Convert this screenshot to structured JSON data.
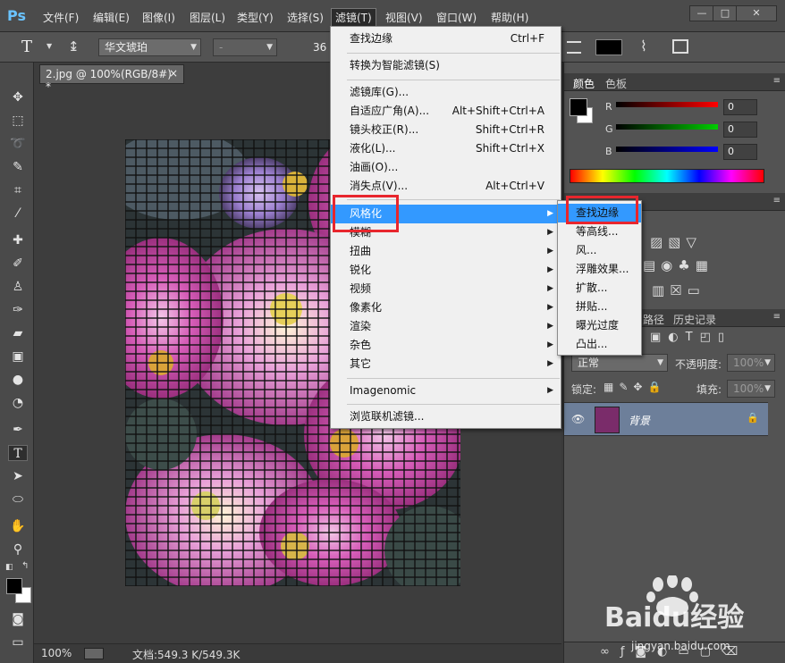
{
  "app": {
    "logo": "Ps"
  },
  "menubar": {
    "items": [
      "文件(F)",
      "编辑(E)",
      "图像(I)",
      "图层(L)",
      "类型(Y)",
      "选择(S)",
      "滤镜(T)",
      "视图(V)",
      "窗口(W)",
      "帮助(H)"
    ],
    "active": "滤镜(T)"
  },
  "window_controls": {
    "minimize": "—",
    "restore": "□",
    "close": "✕"
  },
  "options_bar": {
    "font_family": "华文琥珀",
    "font_style": "-",
    "font_size": "36"
  },
  "document": {
    "tab_title": "2.jpg @ 100%(RGB/8#) *",
    "tab_close": "×"
  },
  "status": {
    "zoom": "100%",
    "doc_info": "文档:549.3 K/549.3K"
  },
  "filter_menu": {
    "items": [
      {
        "label": "查找边缘",
        "shortcut": "Ctrl+F"
      },
      {
        "label": "转换为智能滤镜(S)"
      },
      {
        "label": "滤镜库(G)..."
      },
      {
        "label": "自适应广角(A)...",
        "shortcut": "Alt+Shift+Ctrl+A"
      },
      {
        "label": "镜头校正(R)...",
        "shortcut": "Shift+Ctrl+R"
      },
      {
        "label": "液化(L)...",
        "shortcut": "Shift+Ctrl+X"
      },
      {
        "label": "油画(O)..."
      },
      {
        "label": "消失点(V)...",
        "shortcut": "Alt+Ctrl+V"
      },
      {
        "label": "风格化",
        "submenu": true
      },
      {
        "label": "模糊",
        "submenu": true
      },
      {
        "label": "扭曲",
        "submenu": true
      },
      {
        "label": "锐化",
        "submenu": true
      },
      {
        "label": "视频",
        "submenu": true
      },
      {
        "label": "像素化",
        "submenu": true
      },
      {
        "label": "渲染",
        "submenu": true
      },
      {
        "label": "杂色",
        "submenu": true
      },
      {
        "label": "其它",
        "submenu": true
      },
      {
        "label": "Imagenomic",
        "submenu": true
      },
      {
        "label": "浏览联机滤镜..."
      }
    ]
  },
  "stylize_submenu": {
    "items": [
      "查找边缘",
      "等高线...",
      "风...",
      "浮雕效果...",
      "扩散...",
      "拼贴...",
      "曝光过度",
      "凸出..."
    ]
  },
  "color_panel": {
    "tabs": [
      "颜色",
      "色板"
    ],
    "channels": [
      {
        "label": "R",
        "value": "0",
        "color": "#ff0000"
      },
      {
        "label": "G",
        "value": "0",
        "color": "#00cc00"
      },
      {
        "label": "B",
        "value": "0",
        "color": "#0000ff"
      }
    ]
  },
  "layers_panel": {
    "tabs": [
      "路径",
      "历史记录"
    ],
    "blend_mode": "正常",
    "opacity_label": "不透明度:",
    "opacity_value": "100%",
    "lock_label": "锁定:",
    "fill_label": "填充:",
    "fill_value": "100%",
    "layer_name": "背景"
  },
  "watermark": {
    "brand": "Baidu经验",
    "url": "jingyan.baidu.com"
  },
  "colors": {
    "highlight": "#3399ff",
    "annotation_red": "#e8262d"
  }
}
